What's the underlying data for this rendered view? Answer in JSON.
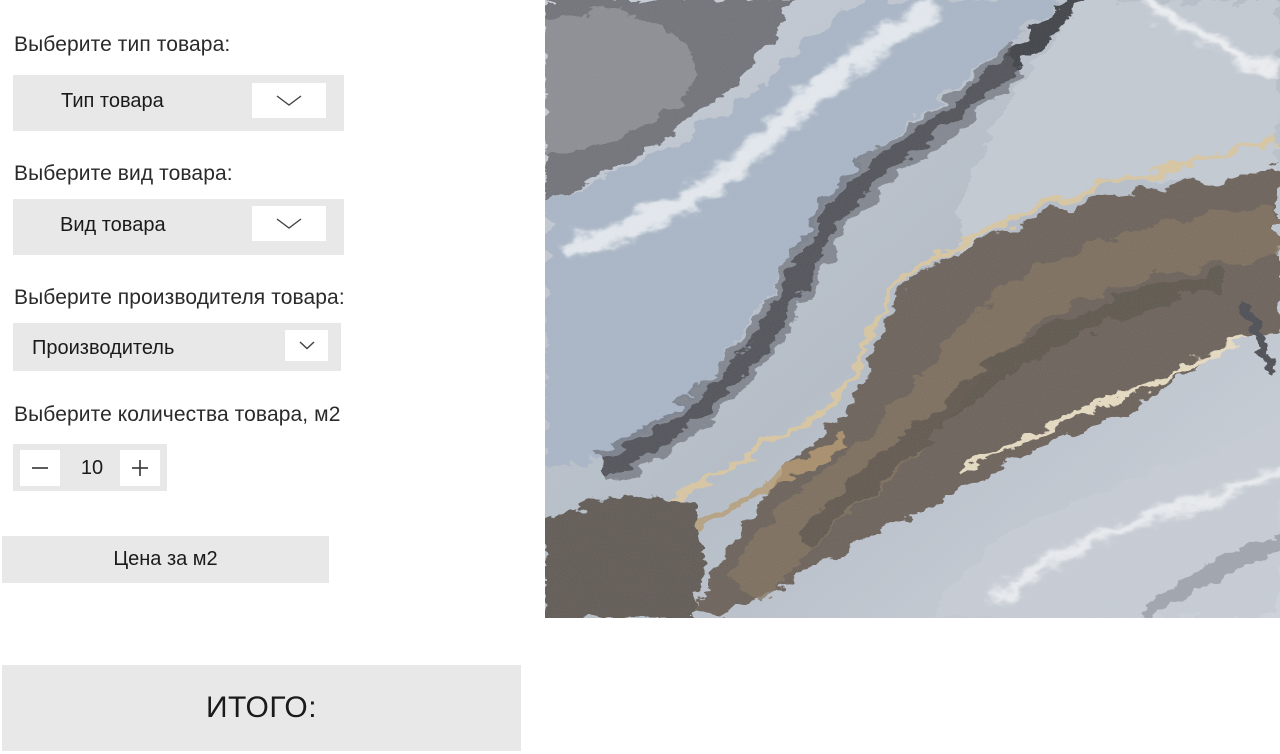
{
  "form": {
    "type_label": "Выберите тип товара:",
    "type_value": "Тип товара",
    "kind_label": "Выберите вид товара:",
    "kind_value": "Вид товара",
    "maker_label": "Выберите производителя товара:",
    "maker_value": "Производитель",
    "qty_label": "Выберите количества товара, м2",
    "qty_value": "10",
    "price_button": "Цена за м2",
    "total_label": "ИТОГО:"
  },
  "icons": {
    "dropdown": "chevron-down-icon",
    "decrement": "minus-icon",
    "increment": "plus-icon"
  },
  "image": {
    "subject": "marble-onyx-texture",
    "palette": [
      "#9aa4b3",
      "#5f5d5c",
      "#7a6a55",
      "#d9c9a8",
      "#dde3ea"
    ]
  },
  "colors": {
    "panel": "#e8e8e8",
    "text": "#1a1a1a",
    "background": "#ffffff"
  }
}
